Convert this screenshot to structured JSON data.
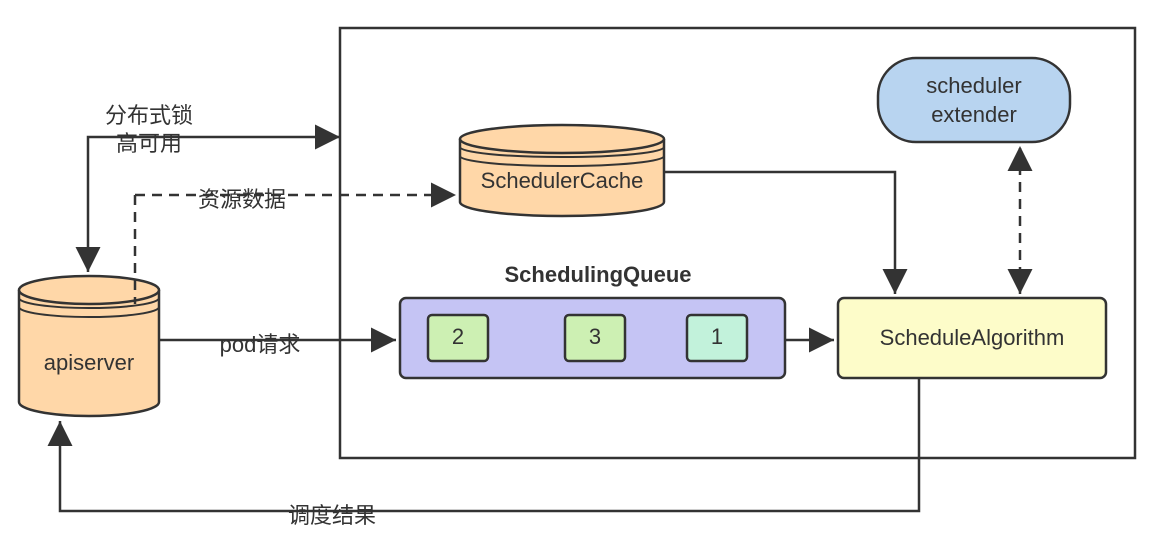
{
  "apiserver": {
    "label": "apiserver"
  },
  "scheduler_cache": {
    "label": "SchedulerCache"
  },
  "scheduling_queue": {
    "label": "SchedulingQueue",
    "items": [
      "2",
      "3",
      "1"
    ]
  },
  "schedule_algorithm": {
    "label": "ScheduleAlgorithm"
  },
  "scheduler_extender": {
    "label": "scheduler\nextender"
  },
  "labels": {
    "distributed_lock": "分布式锁",
    "high_availability": "高可用",
    "resource_data": "资源数据",
    "pod_request": "pod请求",
    "schedule_result": "调度结果"
  }
}
